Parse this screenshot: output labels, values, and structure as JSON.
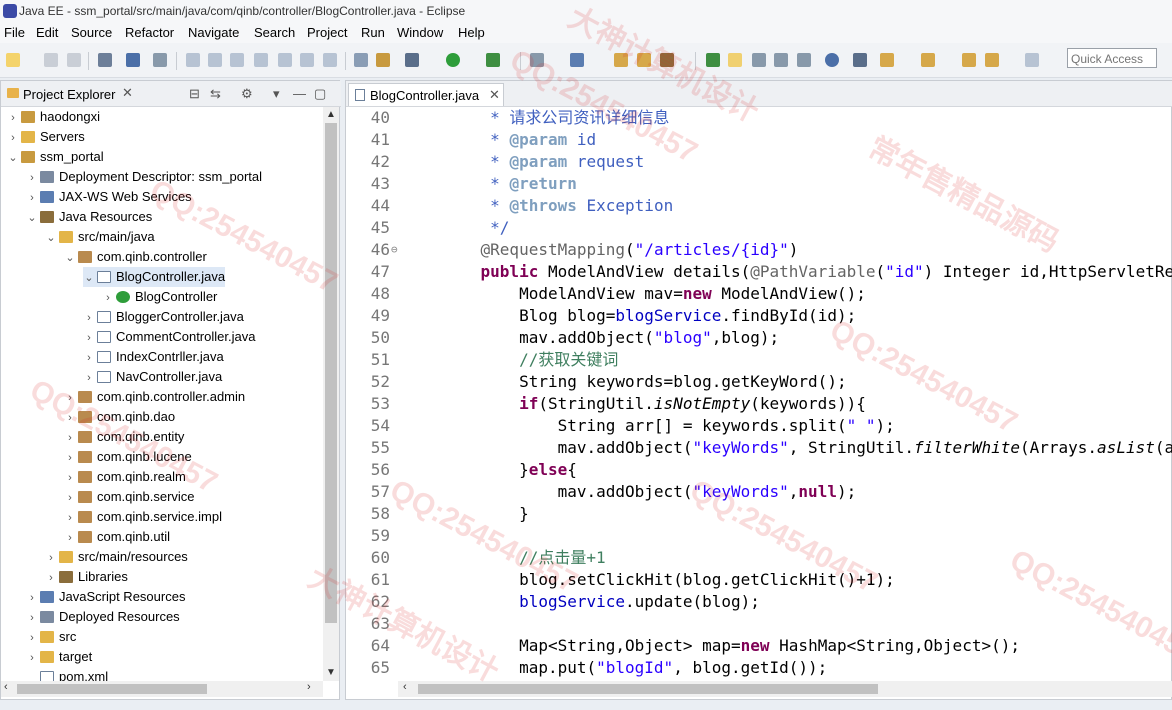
{
  "window": {
    "title": "Java EE - ssm_portal/src/main/java/com/qinb/controller/BlogController.java - Eclipse"
  },
  "menu": [
    "File",
    "Edit",
    "Source",
    "Refactor",
    "Navigate",
    "Search",
    "Project",
    "Run",
    "Window",
    "Help"
  ],
  "quick_access": {
    "placeholder": "Quick Access"
  },
  "project_explorer": {
    "title": "Project Explorer",
    "close": "✕",
    "tree": [
      {
        "label": "haodongxi",
        "depth": 0,
        "twisty": "›",
        "icon": "project-icon"
      },
      {
        "label": "Servers",
        "depth": 0,
        "twisty": "›",
        "icon": "folder-icon"
      },
      {
        "label": "ssm_portal",
        "depth": 0,
        "twisty": "⌄",
        "icon": "project-icon"
      },
      {
        "label": "Deployment Descriptor: ssm_portal",
        "depth": 1,
        "twisty": "›",
        "icon": "descriptor-icon"
      },
      {
        "label": "JAX-WS Web Services",
        "depth": 1,
        "twisty": "›",
        "icon": "webservice-icon"
      },
      {
        "label": "Java Resources",
        "depth": 1,
        "twisty": "⌄",
        "icon": "java-resources-icon"
      },
      {
        "label": "src/main/java",
        "depth": 2,
        "twisty": "⌄",
        "icon": "source-folder-icon"
      },
      {
        "label": "com.qinb.controller",
        "depth": 3,
        "twisty": "⌄",
        "icon": "package-icon"
      },
      {
        "label": "BlogController.java",
        "depth": 4,
        "twisty": "⌄",
        "icon": "java-file-icon",
        "selected": true
      },
      {
        "label": "BlogController",
        "depth": 5,
        "twisty": "›",
        "icon": "class-icon"
      },
      {
        "label": "BloggerController.java",
        "depth": 4,
        "twisty": "›",
        "icon": "java-file-icon"
      },
      {
        "label": "CommentController.java",
        "depth": 4,
        "twisty": "›",
        "icon": "java-file-icon"
      },
      {
        "label": "IndexContrller.java",
        "depth": 4,
        "twisty": "›",
        "icon": "java-file-icon"
      },
      {
        "label": "NavController.java",
        "depth": 4,
        "twisty": "›",
        "icon": "java-file-icon"
      },
      {
        "label": "com.qinb.controller.admin",
        "depth": 3,
        "twisty": "›",
        "icon": "package-icon"
      },
      {
        "label": "com.qinb.dao",
        "depth": 3,
        "twisty": "›",
        "icon": "package-icon"
      },
      {
        "label": "com.qinb.entity",
        "depth": 3,
        "twisty": "›",
        "icon": "package-icon"
      },
      {
        "label": "com.qinb.lucene",
        "depth": 3,
        "twisty": "›",
        "icon": "package-icon"
      },
      {
        "label": "com.qinb.realm",
        "depth": 3,
        "twisty": "›",
        "icon": "package-icon"
      },
      {
        "label": "com.qinb.service",
        "depth": 3,
        "twisty": "›",
        "icon": "package-icon"
      },
      {
        "label": "com.qinb.service.impl",
        "depth": 3,
        "twisty": "›",
        "icon": "package-icon"
      },
      {
        "label": "com.qinb.util",
        "depth": 3,
        "twisty": "›",
        "icon": "package-icon"
      },
      {
        "label": "src/main/resources",
        "depth": 2,
        "twisty": "›",
        "icon": "source-folder-icon"
      },
      {
        "label": "Libraries",
        "depth": 2,
        "twisty": "›",
        "icon": "library-icon"
      },
      {
        "label": "JavaScript Resources",
        "depth": 1,
        "twisty": "›",
        "icon": "js-resources-icon"
      },
      {
        "label": "Deployed Resources",
        "depth": 1,
        "twisty": "›",
        "icon": "deployed-icon"
      },
      {
        "label": "src",
        "depth": 1,
        "twisty": "›",
        "icon": "folder-icon"
      },
      {
        "label": "target",
        "depth": 1,
        "twisty": "›",
        "icon": "folder-icon"
      },
      {
        "label": "pom.xml",
        "depth": 1,
        "twisty": "",
        "icon": "xml-file-icon"
      }
    ]
  },
  "editor": {
    "tab": {
      "label": "BlogController.java",
      "close": "✕"
    },
    "lines": [
      {
        "n": "40",
        "html": "    <span class='doc'> * 请求公司资讯详细信息</span>"
      },
      {
        "n": "41",
        "html": "    <span class='doc'> * <span class='tag'>@param</span> id</span>"
      },
      {
        "n": "42",
        "html": "    <span class='doc'> * <span class='tag'>@param</span> request</span>"
      },
      {
        "n": "43",
        "html": "    <span class='doc'> * <span class='tag'>@return</span></span>"
      },
      {
        "n": "44",
        "html": "    <span class='doc'> * <span class='tag'>@throws</span> Exception</span>"
      },
      {
        "n": "45",
        "html": "    <span class='doc'> */</span>"
      },
      {
        "n": "46",
        "fold": true,
        "html": "    <span class='ann'>@RequestMapping</span>(<span class='str'>\"/articles/{id}\"</span>)"
      },
      {
        "n": "47",
        "html": "    <span class='kw'>public</span> ModelAndView details(<span class='ann'>@PathVariable</span>(<span class='str'>\"id\"</span>) Integer id,HttpServletRequ"
      },
      {
        "n": "48",
        "html": "        ModelAndView mav=<span class='kw'>new</span> ModelAndView();"
      },
      {
        "n": "49",
        "html": "        Blog blog=<span class='fld'>blogService</span>.findById(id);"
      },
      {
        "n": "50",
        "html": "        mav.addObject(<span class='str'>\"blog\"</span>,blog);"
      },
      {
        "n": "51",
        "html": "        <span class='cmt'>//获取关键词</span>"
      },
      {
        "n": "52",
        "html": "        String keywords=blog.getKeyWord();"
      },
      {
        "n": "53",
        "html": "        <span class='kw'>if</span>(StringUtil.<span class='ita'>isNotEmpty</span>(keywords)){"
      },
      {
        "n": "54",
        "html": "            String arr[] = keywords.split(<span class='str'>\" \"</span>);"
      },
      {
        "n": "55",
        "html": "            mav.addObject(<span class='str'>\"keyWords\"</span>, StringUtil.<span class='ita'>filterWhite</span>(Arrays.<span class='ita'>asList</span>(ar"
      },
      {
        "n": "56",
        "html": "        }<span class='kw'>else</span>{"
      },
      {
        "n": "57",
        "html": "            mav.addObject(<span class='str'>\"keyWords\"</span>,<span class='kw'>null</span>);"
      },
      {
        "n": "58",
        "html": "        }"
      },
      {
        "n": "59",
        "html": ""
      },
      {
        "n": "60",
        "html": "        <span class='cmt'>//点击量+1</span>"
      },
      {
        "n": "61",
        "html": "        blog.setClickHit(blog.getClickHit()+1);"
      },
      {
        "n": "62",
        "html": "        <span class='fld'>blogService</span>.update(blog);"
      },
      {
        "n": "63",
        "html": ""
      },
      {
        "n": "64",
        "html": "        Map&lt;String,Object&gt; map=<span class='kw'>new</span> HashMap&lt;String,Object&gt;();"
      },
      {
        "n": "65",
        "html": "        map.put(<span class='str'>\"blogId\"</span>, blog.getId());"
      }
    ]
  },
  "watermarks": [
    "QQ:254540457",
    "常年售精品源码",
    "大神计算机设计"
  ],
  "colors": {
    "keyword": "#7f0055",
    "string": "#2a00ff",
    "comment": "#3f7f5f",
    "javadoc": "#3f5fbf",
    "annotation": "#646464",
    "field": "#0000c0",
    "selection": "#dde8f6"
  }
}
